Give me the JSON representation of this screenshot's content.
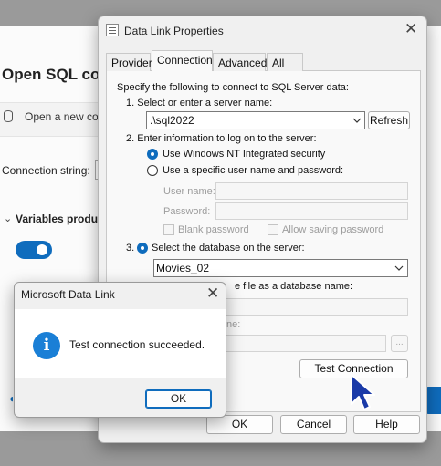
{
  "background_app": {
    "title": "Open SQL conn",
    "new_connection_text": "Open a new co",
    "connection_string_label": "Connection string:",
    "variables_label": "Variables produc",
    "toggle_on": true,
    "accent_color": "#0f6cbd"
  },
  "data_link_dialog": {
    "title": "Data Link Properties",
    "close_glyph": "✕",
    "tabs": [
      {
        "label": "Provider",
        "active": false
      },
      {
        "label": "Connection",
        "active": true
      },
      {
        "label": "Advanced",
        "active": false
      },
      {
        "label": "All",
        "active": false
      }
    ],
    "intro": "Specify the following to connect to SQL Server data:",
    "step1_label": "1. Select or enter a server name:",
    "server_name_value": ".\\sql2022",
    "refresh_label": "Refresh",
    "step2_label": "2. Enter information to log on to the server:",
    "windows_auth_label": "Use Windows NT Integrated security",
    "windows_auth_selected": true,
    "specific_user_label": "Use a specific user name and password:",
    "specific_user_selected": false,
    "user_name_label": "User name:",
    "user_name_value": "",
    "password_label": "Password:",
    "password_value": "",
    "blank_password_label": "Blank password",
    "allow_saving_label": "Allow saving password",
    "step3_label": "3.",
    "select_database_label": "Select the database on the server:",
    "select_database_selected": true,
    "database_value": "Movies_02",
    "attach_file_label": "e file as a database name:",
    "using_filename_label": "ne:",
    "browse_label": "...",
    "test_connection_label": "Test Connection",
    "ok_label": "OK",
    "cancel_label": "Cancel",
    "help_label": "Help"
  },
  "message_box": {
    "title": "Microsoft Data Link",
    "close_glyph": "✕",
    "icon": "info-icon",
    "icon_glyph": "i",
    "message": "Test connection succeeded.",
    "ok_label": "OK"
  },
  "cursor": {
    "icon": "arrow-cursor-icon",
    "color": "#1a3aa8"
  }
}
